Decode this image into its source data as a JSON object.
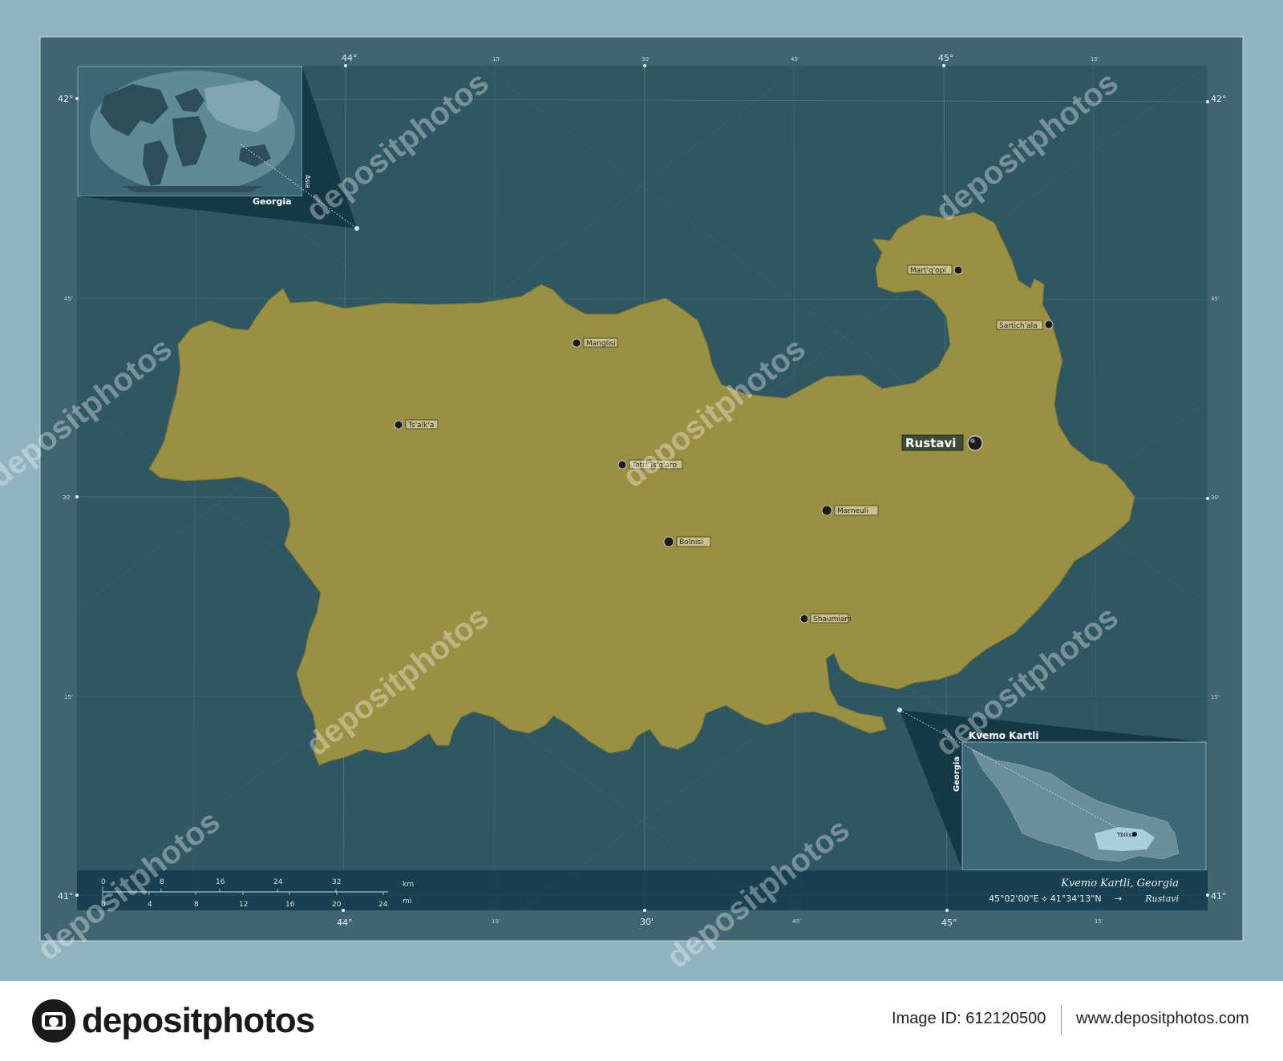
{
  "map": {
    "title": "Kvemo Kartli, Georgia",
    "coordinates": "45°02'00\"E ⟡ 41°34'13\"N",
    "arrow": "→",
    "capital_ref": "Rustavi",
    "region_color": "#9a9042",
    "background_color": "#2f5663",
    "frame_color": "#3f6570",
    "longitude_labels_major": [
      "44°",
      "45°"
    ],
    "longitude_labels_minor": [
      "15'",
      "30'",
      "45'",
      "15'"
    ],
    "latitude_labels_major": [
      "42°",
      "41°"
    ],
    "latitude_labels_minor": [
      "45'",
      "30'",
      "15'"
    ]
  },
  "cities": [
    {
      "name": "Mart'q'opi",
      "capital": false
    },
    {
      "name": "Sartich'ala",
      "capital": false
    },
    {
      "name": "Manglisi",
      "capital": false
    },
    {
      "name": "Ts'alk'a",
      "capital": false
    },
    {
      "name": "Rustavi",
      "capital": true
    },
    {
      "name": "Tetri Ts'q'aro",
      "capital": false
    },
    {
      "name": "Marneuli",
      "capital": false
    },
    {
      "name": "Bolnisi",
      "capital": false
    },
    {
      "name": "Shaumiani",
      "capital": false
    }
  ],
  "inset_world": {
    "country": "Georgia",
    "continent": "Asia"
  },
  "inset_country": {
    "region": "Kvemo Kartli",
    "country": "Georgia",
    "capital": "Tbilisi"
  },
  "scale": {
    "km_ticks": [
      "0",
      "8",
      "16",
      "24",
      "32"
    ],
    "mi_ticks": [
      "0",
      "4",
      "8",
      "12",
      "16",
      "20",
      "24"
    ],
    "km_label": "km",
    "mi_label": "mi"
  },
  "watermark": "depositphotos",
  "footer": {
    "brand": "depositphotos",
    "image_id": "Image ID: 612120500",
    "url": "www.depositphotos.com"
  }
}
